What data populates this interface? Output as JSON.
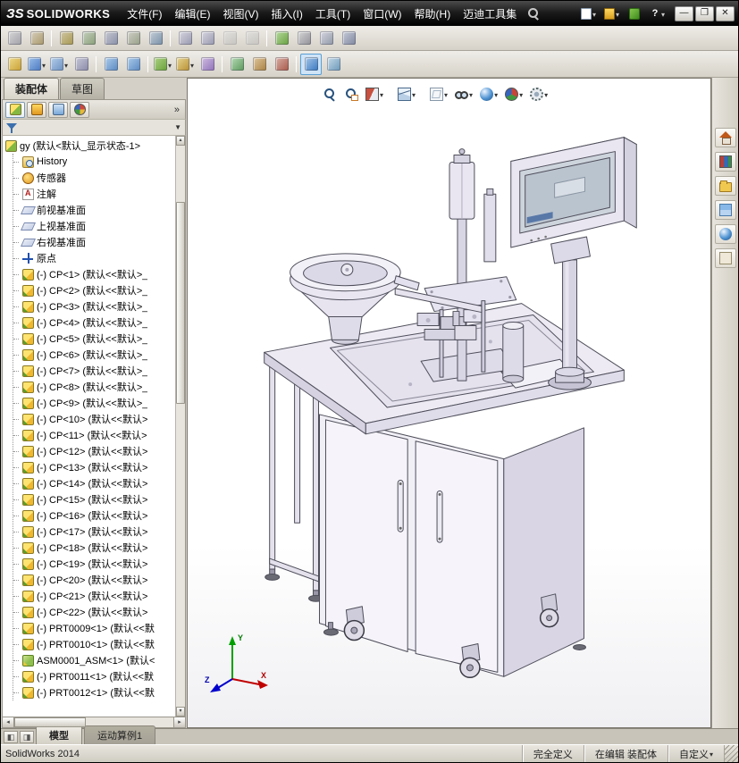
{
  "colors": {
    "titlebar_bg": "#1d1d1d",
    "toolbar_bg": "#ddd9d0",
    "selection_blue": "#cfe4f7",
    "viewport_bg": "#ffffff",
    "chrome_gray": "#d4d0c8"
  },
  "window": {
    "logo_mark": "ЗS",
    "app_name": "SOLIDWORKS",
    "controls": [
      {
        "name": "minimize-button",
        "glyph": "—"
      },
      {
        "name": "restore-button",
        "glyph": "❐"
      },
      {
        "name": "close-button",
        "glyph": "✕"
      }
    ]
  },
  "menu": {
    "items": [
      "文件(F)",
      "编辑(E)",
      "视图(V)",
      "插入(I)",
      "工具(T)",
      "窗口(W)",
      "帮助(H)",
      "迈迪工具集"
    ]
  },
  "quick_access": [
    {
      "name": "new-document-button",
      "icon": "page",
      "cls": "has-dd"
    },
    {
      "name": "open-button",
      "icon": "openfolder",
      "cls": "has-dd"
    },
    {
      "name": "toolbox-button",
      "icon": "greencube"
    },
    {
      "name": "help-button",
      "icon": "q",
      "glyph": "?",
      "cls": "has-dd"
    }
  ],
  "toolbar_row1": {
    "buttons": [
      {
        "name": "select-tool-button",
        "tint": "#d8d8d8",
        "tint2": "#a0a0a8"
      },
      {
        "name": "sketch-entities-button",
        "tint": "#d8d0c0",
        "tint2": "#a89868"
      },
      {
        "sep": true
      },
      {
        "name": "measure-button",
        "tint": "#d0c8a8",
        "tint2": "#a89850"
      },
      {
        "name": "mass-properties-button",
        "tint": "#c8d0c0",
        "tint2": "#88a078"
      },
      {
        "name": "section-properties-button",
        "tint": "#c8c8d0",
        "tint2": "#8890a8"
      },
      {
        "name": "check-model-button",
        "tint": "#d0d0c8",
        "tint2": "#98a088"
      },
      {
        "name": "statistics-button",
        "tint": "#c8d0d8",
        "tint2": "#7890a8"
      },
      {
        "sep": true
      },
      {
        "name": "window-cascade-button",
        "tint": "#d8d8e0",
        "tint2": "#9898b0"
      },
      {
        "name": "window-tile-button",
        "tint": "#d8d8e0",
        "tint2": "#9898b0"
      },
      {
        "name": "full-screen-button",
        "cls": "disabled",
        "tint": "#d8d8d8",
        "tint2": "#b0b0b0"
      },
      {
        "name": "viewport-layout-button",
        "cls": "disabled",
        "tint": "#d8d8d8",
        "tint2": "#b0b0b0"
      },
      {
        "sep": true
      },
      {
        "name": "design-table-button",
        "tint": "#b8dca0",
        "tint2": "#68a040"
      },
      {
        "name": "print-button",
        "tint": "#d8d8d8",
        "tint2": "#909098"
      },
      {
        "name": "print-preview-button",
        "tint": "#d8d8e0",
        "tint2": "#9098a8"
      },
      {
        "name": "options-button",
        "tint": "#c8ccd8",
        "tint2": "#8088a0"
      }
    ]
  },
  "toolbar_row2": {
    "buttons": [
      {
        "name": "insert-components-button",
        "tint": "#f0dc8e",
        "tint2": "#c8a032"
      },
      {
        "name": "mate-button",
        "tint": "#9fc3ec",
        "tint2": "#4a78c0",
        "cls": "has-dd"
      },
      {
        "name": "linear-component-pattern-button",
        "tint": "#b9d1ec",
        "tint2": "#6a90c0",
        "cls": "has-dd"
      },
      {
        "name": "smart-fasteners-button",
        "tint": "#c9c9d9",
        "tint2": "#8a8aa9"
      },
      {
        "sep": true
      },
      {
        "name": "move-component-button",
        "tint": "#afcfec",
        "tint2": "#5a88c0"
      },
      {
        "name": "rotate-component-button",
        "tint": "#afcfec",
        "tint2": "#5a88c0"
      },
      {
        "sep": true
      },
      {
        "name": "assembly-features-button",
        "tint": "#b1d489",
        "tint2": "#68a038",
        "cls": "has-dd"
      },
      {
        "name": "reference-geometry-button",
        "tint": "#e8d897",
        "tint2": "#b89031",
        "cls": "has-dd"
      },
      {
        "name": "new-motion-study-button",
        "tint": "#d1c1e1",
        "tint2": "#9171b9"
      },
      {
        "sep": true
      },
      {
        "name": "bill-of-materials-button",
        "tint": "#b9dcb9",
        "tint2": "#5a985a"
      },
      {
        "name": "exploded-view-button",
        "tint": "#e1c9a1",
        "tint2": "#a98141"
      },
      {
        "name": "explode-line-sketch-button",
        "tint": "#d9b1a9",
        "tint2": "#a95949"
      },
      {
        "sep": true
      },
      {
        "name": "interference-detection-button",
        "tint": "#a9c9e9",
        "tint2": "#3978c0",
        "cls": "active"
      },
      {
        "name": "assembly-visualization-button",
        "tint": "#c9dce9",
        "tint2": "#6a98b9"
      }
    ]
  },
  "command_tabs": {
    "tabs": [
      {
        "name": "tab-assembly",
        "label": "装配体",
        "cls": "active"
      },
      {
        "name": "tab-sketch",
        "label": "草图"
      }
    ]
  },
  "panel": {
    "manager_tabs": [
      {
        "name": "featuremanager-tab",
        "icon": "fm",
        "cls": "active"
      },
      {
        "name": "propertymanager-tab",
        "icon": "pm"
      },
      {
        "name": "configurationmanager-tab",
        "icon": "cm"
      },
      {
        "name": "displaymanager-tab",
        "icon": "dm"
      }
    ],
    "overflow_glyph": "»",
    "filter_dropdown_glyph": "▼"
  },
  "tree": {
    "root": "gy (默认<默认_显示状态-1>",
    "items": [
      {
        "icon": "history",
        "label": "History"
      },
      {
        "icon": "sensor",
        "label": "传感器"
      },
      {
        "icon": "annotation",
        "label": "注解"
      },
      {
        "icon": "plane",
        "label": "前视基准面"
      },
      {
        "icon": "plane",
        "label": "上视基准面"
      },
      {
        "icon": "plane",
        "label": "右视基准面"
      },
      {
        "icon": "origin",
        "label": "原点"
      },
      {
        "icon": "component",
        "label": "(-) CP<1> (默认<<默认>_"
      },
      {
        "icon": "component",
        "label": "(-) CP<2> (默认<<默认>_"
      },
      {
        "icon": "component",
        "label": "(-) CP<3> (默认<<默认>_"
      },
      {
        "icon": "component",
        "label": "(-) CP<4> (默认<<默认>_"
      },
      {
        "icon": "component",
        "label": "(-) CP<5> (默认<<默认>_"
      },
      {
        "icon": "component",
        "label": "(-) CP<6> (默认<<默认>_"
      },
      {
        "icon": "component",
        "label": "(-) CP<7> (默认<<默认>_"
      },
      {
        "icon": "component",
        "label": "(-) CP<8> (默认<<默认>_"
      },
      {
        "icon": "component",
        "label": "(-) CP<9> (默认<<默认>_"
      },
      {
        "icon": "component",
        "label": "(-) CP<10> (默认<<默认>"
      },
      {
        "icon": "component",
        "label": "(-) CP<11> (默认<<默认>"
      },
      {
        "icon": "component",
        "label": "(-) CP<12> (默认<<默认>"
      },
      {
        "icon": "component",
        "label": "(-) CP<13> (默认<<默认>"
      },
      {
        "icon": "component",
        "label": "(-) CP<14> (默认<<默认>"
      },
      {
        "icon": "component",
        "label": "(-) CP<15> (默认<<默认>"
      },
      {
        "icon": "component",
        "label": "(-) CP<16> (默认<<默认>"
      },
      {
        "icon": "component",
        "label": "(-) CP<17> (默认<<默认>"
      },
      {
        "icon": "component",
        "label": "(-) CP<18> (默认<<默认>"
      },
      {
        "icon": "component",
        "label": "(-) CP<19> (默认<<默认>"
      },
      {
        "icon": "component",
        "label": "(-) CP<20> (默认<<默认>"
      },
      {
        "icon": "component",
        "label": "(-) CP<21> (默认<<默认>"
      },
      {
        "icon": "component",
        "label": "(-) CP<22> (默认<<默认>"
      },
      {
        "icon": "component",
        "label": "(-) PRT0009<1> (默认<<默"
      },
      {
        "icon": "component",
        "label": "(-) PRT0010<1> (默认<<默"
      },
      {
        "icon": "assembly",
        "label": "ASM0001_ASM<1> (默认<"
      },
      {
        "icon": "component",
        "label": "(-) PRT0011<1> (默认<<默"
      },
      {
        "icon": "component",
        "label": "(-) PRT0012<1> (默认<<默"
      }
    ]
  },
  "headsup": {
    "buttons": [
      {
        "name": "zoom-to-fit-button",
        "icon": "mag"
      },
      {
        "name": "zoom-to-area-button",
        "icon": "magrect"
      },
      {
        "name": "section-view-button",
        "icon": "section",
        "cls": "has-dd"
      },
      {
        "sep": true
      },
      {
        "name": "view-orientation-button",
        "icon": "cube",
        "cls": "has-dd"
      },
      {
        "sep": true
      },
      {
        "name": "display-style-button",
        "icon": "cube2",
        "cls": "has-dd"
      },
      {
        "name": "hide-show-items-button",
        "icon": "glasses",
        "cls": "has-dd"
      },
      {
        "name": "edit-appearance-button",
        "icon": "ball",
        "cls": "has-dd"
      },
      {
        "name": "apply-scene-button",
        "icon": "pie",
        "cls": "has-dd"
      },
      {
        "name": "view-settings-button",
        "icon": "gear",
        "cls": "has-dd"
      }
    ]
  },
  "taskpane": {
    "buttons": [
      {
        "name": "solidworks-resources-button",
        "icon": "home"
      },
      {
        "name": "design-library-button",
        "icon": "library"
      },
      {
        "name": "file-explorer-button",
        "icon": "folder"
      },
      {
        "name": "view-palette-button",
        "icon": "palette"
      },
      {
        "name": "appearances-button",
        "icon": "ball"
      },
      {
        "name": "custom-properties-button",
        "icon": "doc"
      }
    ]
  },
  "viewport": {
    "triad": {
      "x": "X",
      "y": "Y",
      "z": "Z"
    }
  },
  "bottom_bar": {
    "buttons": [
      {
        "name": "split-horizontal-button",
        "glyph": "◧"
      },
      {
        "name": "split-vertical-button",
        "glyph": "◨"
      }
    ],
    "tabs": [
      {
        "name": "tab-model",
        "label": "模型",
        "cls": "active"
      },
      {
        "name": "tab-motion-study",
        "label": "运动算例1"
      }
    ]
  },
  "status_bar": {
    "left": "SolidWorks 2014",
    "cells": [
      {
        "label": "完全定义"
      },
      {
        "label": "在编辑 装配体"
      },
      {
        "label": "自定义",
        "cls": "has-dd"
      }
    ]
  }
}
